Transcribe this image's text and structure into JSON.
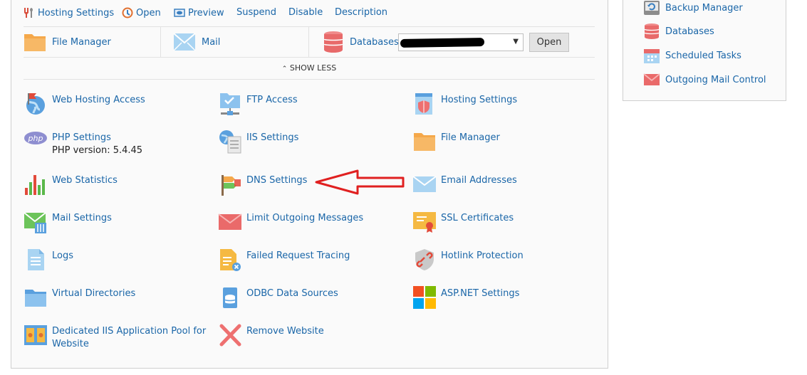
{
  "toolbar": {
    "hosting_settings": "Hosting Settings",
    "open": "Open",
    "preview": "Preview",
    "suspend": "Suspend",
    "disable": "Disable",
    "description": "Description"
  },
  "quick": {
    "file_manager": "File Manager",
    "mail": "Mail",
    "databases": "Databases",
    "open_button": "Open"
  },
  "show_less": "SHOW LESS",
  "tools": {
    "web_hosting_access": "Web Hosting Access",
    "ftp_access": "FTP Access",
    "hosting_settings": "Hosting Settings",
    "php_settings": "PHP Settings",
    "php_version": "PHP version: 5.4.45",
    "iis_settings": "IIS Settings",
    "file_manager": "File Manager",
    "web_statistics": "Web Statistics",
    "dns_settings": "DNS Settings",
    "email_addresses": "Email Addresses",
    "mail_settings": "Mail Settings",
    "limit_outgoing": "Limit Outgoing Messages",
    "ssl_certificates": "SSL Certificates",
    "logs": "Logs",
    "failed_request": "Failed Request Tracing",
    "hotlink": "Hotlink Protection",
    "virtual_dirs": "Virtual Directories",
    "odbc": "ODBC Data Sources",
    "aspnet": "ASP.NET Settings",
    "dedicated_pool_1": "Dedicated IIS Application Pool for",
    "dedicated_pool_2": "Website",
    "remove_website": "Remove Website"
  },
  "sidebar": {
    "backup_manager": "Backup Manager",
    "databases": "Databases",
    "scheduled_tasks": "Scheduled Tasks",
    "outgoing_mail_control": "Outgoing Mail Control"
  },
  "colors": {
    "link": "#1a66a8",
    "annotation_arrow": "#e02020"
  }
}
